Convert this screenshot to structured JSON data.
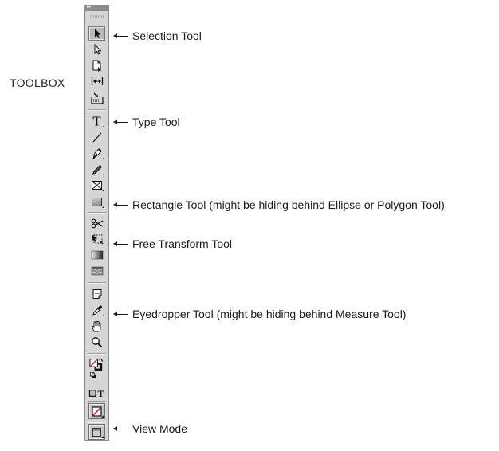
{
  "title": "TOOLBOX",
  "toolbox": {
    "collapse_glyph": "▸▸",
    "tools": [
      {
        "id": "selection",
        "name": "Selection Tool",
        "icon": "arrow-solid-icon",
        "selected": true
      },
      {
        "id": "direct-selection",
        "name": "Direct Selection Tool",
        "icon": "arrow-hollow-icon"
      },
      {
        "id": "page",
        "name": "Page Tool",
        "icon": "page-icon"
      },
      {
        "id": "gap",
        "name": "Gap Tool",
        "icon": "gap-icon"
      },
      {
        "id": "content-collector",
        "name": "Content Collector Tool",
        "icon": "content-collector-icon"
      },
      {
        "id": "type",
        "name": "Type Tool",
        "icon": "type-icon"
      },
      {
        "id": "line",
        "name": "Line Tool",
        "icon": "line-icon"
      },
      {
        "id": "pen",
        "name": "Pen Tool",
        "icon": "pen-icon"
      },
      {
        "id": "pencil",
        "name": "Pencil Tool",
        "icon": "pencil-icon"
      },
      {
        "id": "rectangle-frame",
        "name": "Rectangle Frame Tool",
        "icon": "rectangle-frame-icon"
      },
      {
        "id": "rectangle",
        "name": "Rectangle Tool",
        "icon": "rectangle-icon"
      },
      {
        "id": "scissors",
        "name": "Scissors Tool",
        "icon": "scissors-icon"
      },
      {
        "id": "free-transform",
        "name": "Free Transform Tool",
        "icon": "free-transform-icon"
      },
      {
        "id": "gradient-swatch",
        "name": "Gradient Swatch Tool",
        "icon": "gradient-swatch-icon"
      },
      {
        "id": "gradient-feather",
        "name": "Gradient Feather Tool",
        "icon": "gradient-feather-icon"
      },
      {
        "id": "note",
        "name": "Note Tool",
        "icon": "note-icon"
      },
      {
        "id": "eyedropper",
        "name": "Eyedropper Tool",
        "icon": "eyedropper-icon"
      },
      {
        "id": "hand",
        "name": "Hand Tool",
        "icon": "hand-icon"
      },
      {
        "id": "zoom",
        "name": "Zoom Tool",
        "icon": "zoom-icon"
      },
      {
        "id": "fill-stroke",
        "name": "Fill and Stroke",
        "icon": "fill-stroke-icon"
      },
      {
        "id": "format-container-text",
        "name": "Formatting Affects Container / Text",
        "icon": "format-container-text-icon",
        "text_glyph": "T"
      },
      {
        "id": "apply-none",
        "name": "Apply None",
        "icon": "apply-none-icon"
      },
      {
        "id": "view-mode",
        "name": "View Mode",
        "icon": "view-mode-icon"
      }
    ]
  },
  "callouts": [
    {
      "target": "selection",
      "label": "Selection Tool"
    },
    {
      "target": "type",
      "label": "Type Tool"
    },
    {
      "target": "rectangle",
      "label": "Rectangle Tool (might be hiding behind Ellipse or Polygon Tool)"
    },
    {
      "target": "free-transform",
      "label": "Free Transform Tool"
    },
    {
      "target": "eyedropper",
      "label": "Eyedropper Tool (might be hiding behind Measure Tool)"
    },
    {
      "target": "view-mode",
      "label": "View Mode"
    }
  ],
  "colors": {
    "panel": "#d6d6d6",
    "header": "#8c8c8c",
    "stroke_red": "#d0202a",
    "text": "#1a1a1a"
  }
}
